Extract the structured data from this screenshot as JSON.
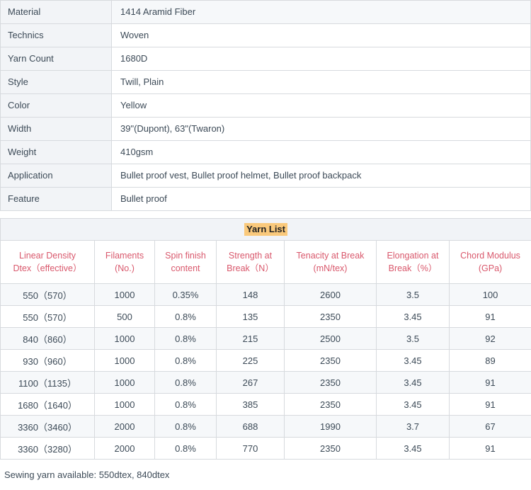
{
  "spec": {
    "rows": [
      {
        "label": "Material",
        "value": "1414 Aramid Fiber"
      },
      {
        "label": "Technics",
        "value": "Woven"
      },
      {
        "label": "Yarn Count",
        "value": "1680D"
      },
      {
        "label": "Style",
        "value": "Twill, Plain"
      },
      {
        "label": "Color",
        "value": "Yellow"
      },
      {
        "label": "Width",
        "value": "39\"(Dupont), 63\"(Twaron)"
      },
      {
        "label": "Weight",
        "value": "410gsm"
      },
      {
        "label": "Application",
        "value": "Bullet proof vest, Bullet proof helmet, Bullet proof backpack"
      },
      {
        "label": "Feature",
        "value": "Bullet proof"
      }
    ]
  },
  "yarn": {
    "caption": "Yarn List",
    "headers": [
      {
        "line1": "Linear Density",
        "line2": "Dtex（effective）"
      },
      {
        "line1": "Filaments",
        "line2": "(No.)"
      },
      {
        "line1": "Spin finish",
        "line2": "content"
      },
      {
        "line1": "Strength at",
        "line2": "Break（N）"
      },
      {
        "line1": "Tenacity at Break",
        "line2": "(mN/tex)"
      },
      {
        "line1": "Elongation at",
        "line2": "Break（%）"
      },
      {
        "line1": "Chord Modulus",
        "line2": "(GPa)"
      }
    ],
    "rows": [
      [
        "550（570）",
        "1000",
        "0.35%",
        "148",
        "2600",
        "3.5",
        "100"
      ],
      [
        "550（570）",
        "500",
        "0.8%",
        "135",
        "2350",
        "3.45",
        "91"
      ],
      [
        "840（860）",
        "1000",
        "0.8%",
        "215",
        "2500",
        "3.5",
        "92"
      ],
      [
        "930（960）",
        "1000",
        "0.8%",
        "225",
        "2350",
        "3.45",
        "89"
      ],
      [
        "1100（1135）",
        "1000",
        "0.8%",
        "267",
        "2350",
        "3.45",
        "91"
      ],
      [
        "1680（1640）",
        "1000",
        "0.8%",
        "385",
        "2350",
        "3.45",
        "91"
      ],
      [
        "3360（3460）",
        "2000",
        "0.8%",
        "688",
        "1990",
        "3.7",
        "67"
      ],
      [
        "3360（3280）",
        "2000",
        "0.8%",
        "770",
        "2350",
        "3.45",
        "91"
      ]
    ]
  },
  "footer": {
    "note": "Sewing yarn available: 550dtex, 840dtex"
  },
  "colors": {
    "header_text": "#d9586c",
    "highlight_bg": "#fac97c",
    "body_text": "#3c4a57",
    "border": "#d7dade",
    "row_alt_bg": "#f6f8fa",
    "label_bg": "#f2f4f7"
  }
}
